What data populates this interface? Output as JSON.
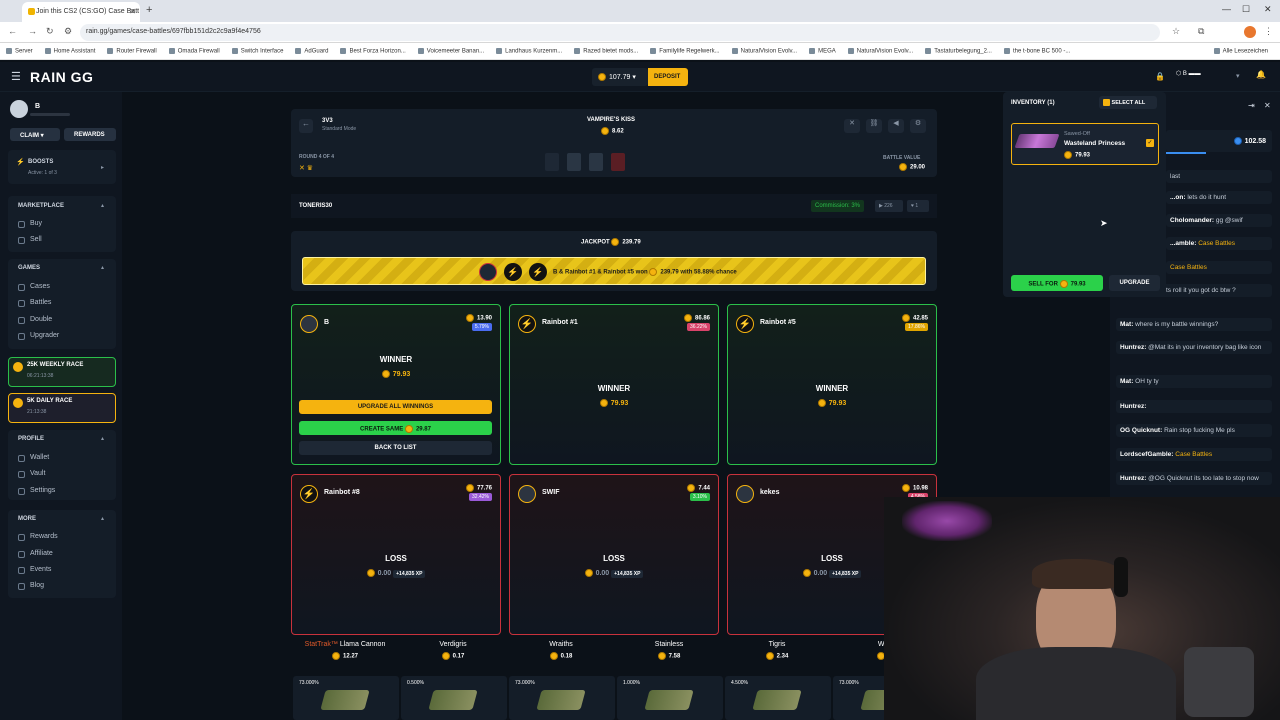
{
  "browser": {
    "tab_title": "Join this CS2 (CS:GO) Case Batt",
    "url": "rain.gg/games/case-battles/697fbb151d2c2c9a9f4e4756",
    "bookmarks": [
      "Server",
      "Home Assistant",
      "Router Firewall",
      "Omada Firewall",
      "Switch Interface",
      "AdGuard",
      "Best Forza Horizon...",
      "Voicemeeter Banan...",
      "Landhaus Kurzenm...",
      "Razed bietet mods...",
      "Familylife Regelwerk...",
      "NaturalVision Evolv...",
      "MEGA",
      "NaturalVision Evolv...",
      "Tastaturbelegung_2...",
      "the t-bone BC 500 -..."
    ],
    "bookmarks_more": "Alle Lesezeichen"
  },
  "header": {
    "logo": "RAIN GG",
    "balance": "107.79",
    "deposit_label": "DEPOSIT"
  },
  "sidebar": {
    "user_name": "B",
    "claim_label": "CLAIM",
    "rewards_label": "REWARDS",
    "boosts_title": "BOOSTS",
    "boosts_sub": "Active: 1 of 3",
    "marketplace_title": "MARKETPLACE",
    "marketplace_items": [
      "Buy",
      "Sell"
    ],
    "games_title": "GAMES",
    "games_items": [
      "Cases",
      "Battles",
      "Double",
      "Upgrader"
    ],
    "weekly_race": {
      "title": "25K WEEKLY RACE",
      "timer": "06:21:13:38"
    },
    "daily_race": {
      "title": "5K DAILY RACE",
      "timer": "21:13:38"
    },
    "profile_title": "PROFILE",
    "profile_items": [
      "Wallet",
      "Vault",
      "Settings"
    ],
    "more_title": "MORE",
    "more_items": [
      "Rewards",
      "Affiliate",
      "Events",
      "Blog"
    ]
  },
  "battle": {
    "mode": "3V3",
    "mode_sub": "Standard Mode",
    "case_name": "VAMPIRE'S KISS",
    "case_price": "8.62",
    "round": "ROUND 4 OF 4",
    "battle_value_label": "BATTLE VALUE",
    "battle_value": "29.00",
    "creator": "TONERIS30",
    "commission": "Commission: 3%",
    "stat_views": "226",
    "stat_likes": "1",
    "jackpot_label": "JACKPOT",
    "jackpot_value": "239.79",
    "jackpot_text_pre": "B & Rainbot #1 & Rainbot #5 won",
    "jackpot_text_amount": "239.79",
    "jackpot_text_post": "with 58.88% chance"
  },
  "players": [
    {
      "name": "B",
      "value": "13.90",
      "pct": "5.79%",
      "pct_color": "#4a6cf0",
      "result": "WINNER",
      "amount": "79.93"
    },
    {
      "name": "Rainbot #1",
      "value": "86.86",
      "pct": "36.22%",
      "pct_color": "#d9436a",
      "result": "WINNER",
      "amount": "79.93"
    },
    {
      "name": "Rainbot #5",
      "value": "42.85",
      "pct": "17.86%",
      "pct_color": "#e0a500",
      "result": "WINNER",
      "amount": "79.93"
    },
    {
      "name": "Rainbot #8",
      "value": "77.76",
      "pct": "32.42%",
      "pct_color": "#9a5ad8",
      "result": "LOSS",
      "amount": "0.00",
      "xp": "+14,835 XP"
    },
    {
      "name": "SWIF",
      "value": "7.44",
      "pct": "3.10%",
      "pct_color": "#2bbf4a",
      "result": "LOSS",
      "amount": "0.00",
      "xp": "+14,835 XP"
    },
    {
      "name": "kekes",
      "value": "10.98",
      "pct": "4.58%",
      "pct_color": "#d9436a",
      "result": "LOSS",
      "amount": "0.00",
      "xp": "+14,835 XP"
    }
  ],
  "winner_actions": {
    "upgrade_all": "UPGRADE ALL WINNINGS",
    "create_same": "CREATE SAME",
    "create_same_price": "29.87",
    "back_to_list": "BACK TO LIST"
  },
  "items": [
    {
      "prefix": "StatTrak™",
      "name": "Llama Cannon",
      "value": "12.27",
      "odds": "73.000%"
    },
    {
      "prefix": "",
      "name": "Verdigris",
      "value": "0.17",
      "odds": "0.500%"
    },
    {
      "prefix": "",
      "name": "Wraiths",
      "value": "0.18",
      "odds": "73.000%"
    },
    {
      "prefix": "",
      "name": "Stainless",
      "value": "7.58",
      "odds": "1.000%"
    },
    {
      "prefix": "",
      "name": "Tigris",
      "value": "2.34",
      "odds": "4.500%"
    },
    {
      "prefix": "",
      "name": "Wrai",
      "value": "0.",
      "odds": "73.000%"
    }
  ],
  "inventory": {
    "title": "INVENTORY (1)",
    "select_all": "SELECT ALL",
    "item_type": "Sawed-Off",
    "item_name": "Wasteland Princess",
    "item_value": "79.93",
    "sell_label": "SELL FOR",
    "sell_value": "79.93",
    "upgrade_label": "UPGRADE"
  },
  "chat": {
    "balance": "102.58",
    "messages": [
      {
        "user": "",
        "text": "last",
        "case": false
      },
      {
        "user": "...on:",
        "text": "lets do it hunt",
        "case": false
      },
      {
        "user": "Cholomander:",
        "text": "gg @swif",
        "case": false
      },
      {
        "user": "...amble:",
        "text": "Case Battles",
        "case": true
      },
      {
        "user": "",
        "text": "Case Battles",
        "case": true
      },
      {
        "user": "",
        "text": "Tryllemanden lets roll it you got dc btw ?",
        "case": false
      },
      {
        "user": "Mat:",
        "text": "where is my battle winnings?",
        "case": false
      },
      {
        "user": "Huntrez:",
        "text": "@Mat its in your inventory bag like icon",
        "case": false
      },
      {
        "user": "Mat:",
        "text": "OH ty ty",
        "case": false
      },
      {
        "user": "Huntrez:",
        "text": "",
        "case": false
      },
      {
        "user": "OG Quicknut:",
        "text": "Rain stop fucking Me pls",
        "case": false
      },
      {
        "user": "LordscefGamble:",
        "text": "Case Battles",
        "case": true
      },
      {
        "user": "Huntrez:",
        "text": "@OG Quicknut its too late to stop now",
        "case": false
      }
    ]
  },
  "colors": {
    "gold": "#f5b30f",
    "win": "#2bbf4a",
    "loss": "#c8323c",
    "panel": "#141d28"
  }
}
